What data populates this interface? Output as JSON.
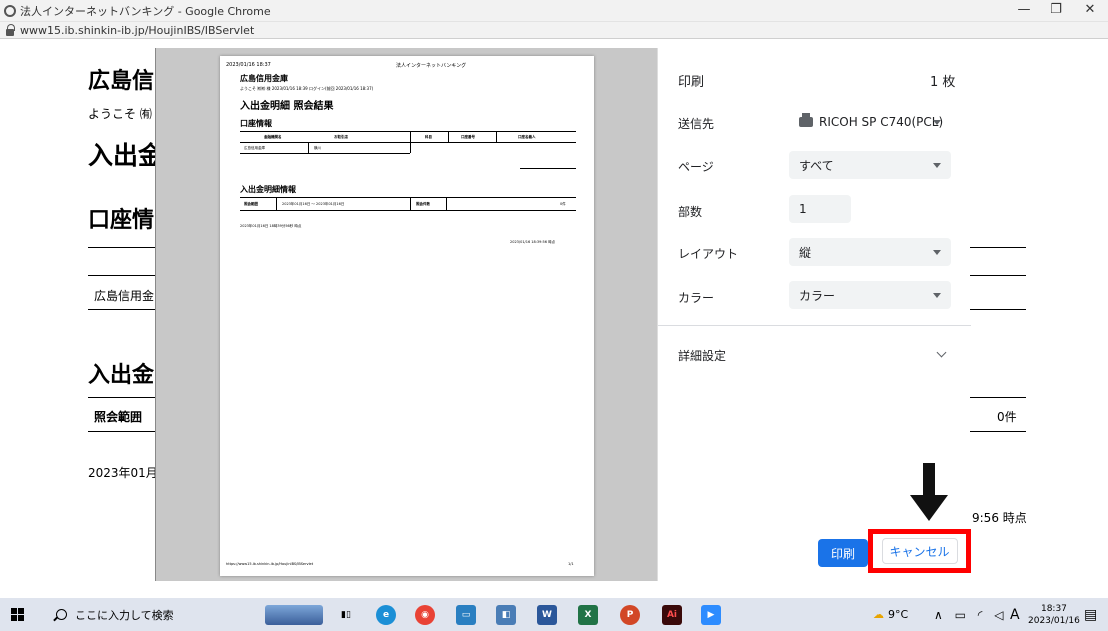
{
  "window": {
    "title": "法人インターネットバンキング - Google Chrome",
    "url": "www15.ib.shinkin-ib.jp/HoujinIBS/IBServlet",
    "min_label": "—",
    "max_label": "❐",
    "close_label": "✕"
  },
  "background_page": {
    "bank_name": "広島信",
    "welcome": "ようこそ ㈲",
    "heading_main": "入出金",
    "heading_account": "口座情",
    "account_bank": "広島信用金",
    "heading_detail": "入出金",
    "range_label": "照会範囲",
    "count_value": "0件",
    "date_partial": "2023年01月:",
    "time_partial": "9:56 時点"
  },
  "preview": {
    "timestamp": "2023/01/16 18:37",
    "header_title": "法人インターネットバンキング",
    "bank_name": "広島信用金庫",
    "welcome_line": "ようこそ ㈲㈲ 様  2023/01/16 18:39 ログイン(前回 2023/01/16 18:37)",
    "title": "入出金明細 照会結果",
    "account_section": "口座情報",
    "col_bank": "金融機関名",
    "col_branch": "お取引店",
    "col_type": "科目",
    "col_number": "口座番号",
    "col_holder": "口座名義人",
    "cell_bank": "広島信用金庫",
    "cell_branch": "横川",
    "detail_section": "入出金明細情報",
    "range_label": "照会範囲",
    "range_value": "2023年01月16日 〜 2023年01月16日",
    "count_label": "照会件数",
    "count_value": "0件",
    "asof_line": "2023年01月16日 18時39分56秒 時点",
    "asof_right": "2023/01/16 18:39:56 時点",
    "footer_url": "https://www15.ib.shinkin-ib.jp/HoujinIBS/IBServlet",
    "footer_page": "1/1"
  },
  "print_settings": {
    "title": "印刷",
    "sheet_count": "1 枚",
    "destination_label": "送信先",
    "destination_value": "RICOH SP C740(PCL)",
    "pages_label": "ページ",
    "pages_value": "すべて",
    "copies_label": "部数",
    "copies_value": "1",
    "layout_label": "レイアウト",
    "layout_value": "縦",
    "color_label": "カラー",
    "color_value": "カラー",
    "advanced_label": "詳細設定",
    "print_button": "印刷",
    "cancel_button": "キャンセル"
  },
  "taskbar": {
    "search_placeholder": "ここに入力して検索",
    "weather": "9°C",
    "ime": "A",
    "time": "18:37",
    "date": "2023/01/16"
  },
  "colors": {
    "accent": "#1a73e8",
    "highlight": "#ff0000"
  }
}
